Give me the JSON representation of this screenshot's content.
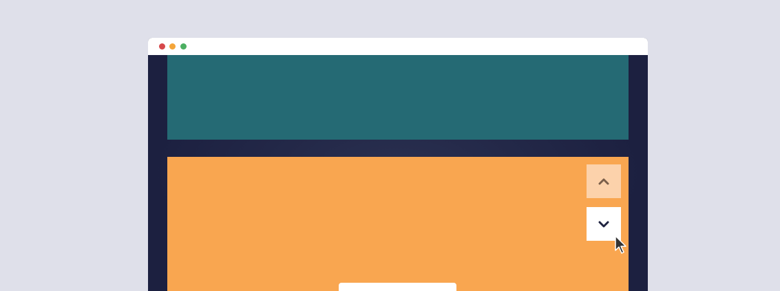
{
  "window": {
    "controls": [
      {
        "name": "close",
        "color": "#d6484b"
      },
      {
        "name": "minimize",
        "color": "#f4a53a"
      },
      {
        "name": "maximize",
        "color": "#4caf62"
      }
    ]
  },
  "sections": [
    {
      "name": "teal-section",
      "color": "#256a74"
    },
    {
      "name": "orange-section",
      "color": "#f9a650"
    }
  ],
  "navigation": {
    "up": {
      "icon": "chevron-up-icon",
      "background": "#fcd2ab",
      "icon_color": "#7a5f4a"
    },
    "down": {
      "icon": "chevron-down-icon",
      "background": "#ffffff",
      "icon_color": "#1f2340"
    }
  },
  "cursor": {
    "icon": "mouse-pointer-icon"
  }
}
